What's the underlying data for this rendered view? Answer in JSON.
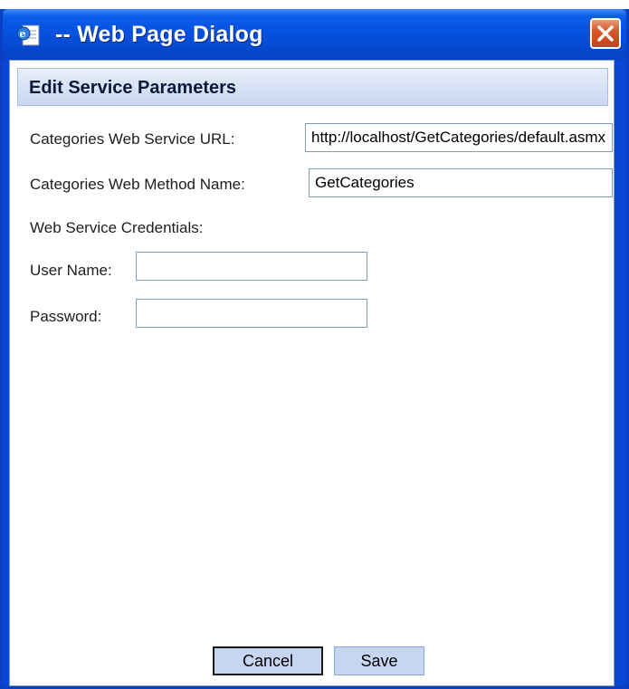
{
  "window": {
    "title": "-- Web Page Dialog",
    "app_icon": "ie-page-icon",
    "close_icon": "close-icon"
  },
  "section": {
    "title": "Edit Service Parameters"
  },
  "form": {
    "categories_url": {
      "label": "Categories Web Service URL:",
      "value": "http://localhost/GetCategories/default.asmx"
    },
    "categories_method": {
      "label": "Categories Web Method Name:",
      "value": "GetCategories"
    },
    "credentials_heading": "Web Service Credentials:",
    "user_name": {
      "label": "User Name:",
      "value": ""
    },
    "password": {
      "label": "Password:",
      "value": ""
    }
  },
  "buttons": {
    "cancel_label": "Cancel",
    "save_label": "Save"
  },
  "colors": {
    "titlebar": "#0752e0",
    "close": "#d8562a",
    "header_bg": "#c9d7f1",
    "button_bg": "#c6d6f2"
  }
}
